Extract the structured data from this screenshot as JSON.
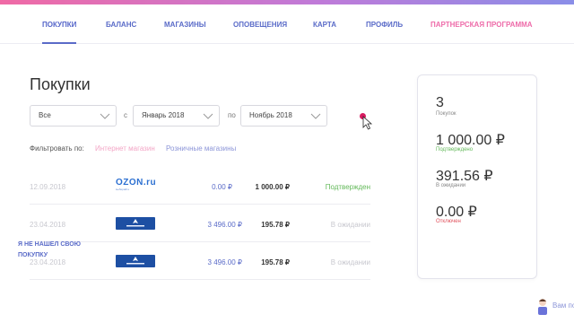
{
  "nav": {
    "tabs": [
      {
        "label": "ПОКУПКИ",
        "active": true
      },
      {
        "label": "БАЛАНС"
      },
      {
        "label": "МАГАЗИНЫ"
      },
      {
        "label": "ОПОВЕЩЕНИЯ"
      },
      {
        "label": "КАРТА"
      },
      {
        "label": "ПРОФИЛЬ"
      },
      {
        "label": "ПАРТНЕРСКАЯ ПРОГРАММА",
        "accent": "#ee6ba9"
      }
    ]
  },
  "page": {
    "title": "Покупки"
  },
  "filters": {
    "status_select": "Все",
    "from_label": "с",
    "from_select": "Январь 2018",
    "to_label": "по",
    "to_select": "Ноябрь 2018",
    "filter_label": "Фильтровать по:",
    "online_link": "Интернет магазин",
    "retail_link": "Розничные магазины"
  },
  "purchases": [
    {
      "date": "12.09.2018",
      "store_logo": "ozon-logo",
      "logo_word": "OZON.ru",
      "logo_sub": "выбирайте",
      "amount": "0.00 ₽",
      "cashback": "1 000.00 ₽",
      "status": "Подтвержден",
      "status_type": "confirmed"
    },
    {
      "date": "23.04.2018",
      "store_logo": "sportmaster-logo",
      "amount": "3 496.00 ₽",
      "cashback": "195.78 ₽",
      "status": "В ожидании",
      "status_type": "pending"
    },
    {
      "date": "23.04.2018",
      "store_logo": "sportmaster-logo",
      "amount": "3 496.00 ₽",
      "cashback": "195.78 ₽",
      "status": "В ожидании",
      "status_type": "pending"
    }
  ],
  "summary": {
    "count_value": "3",
    "count_label": "Покупок",
    "confirmed_value": "1 000.00 ₽",
    "confirmed_label": "Подтверждено",
    "pending_value": "391.56 ₽",
    "pending_label": "В ожидании",
    "cancelled_value": "0.00 ₽",
    "cancelled_label": "Отключен",
    "not_found_link": "Я НЕ НАШЕЛ СВОЮ ПОКУПКУ"
  },
  "chat": {
    "label": "Вам по"
  },
  "colors": {
    "accent": "#5a6bc8",
    "partner": "#ee6ba9",
    "confirmed": "#63b95a",
    "cancelled": "#e0505b"
  }
}
